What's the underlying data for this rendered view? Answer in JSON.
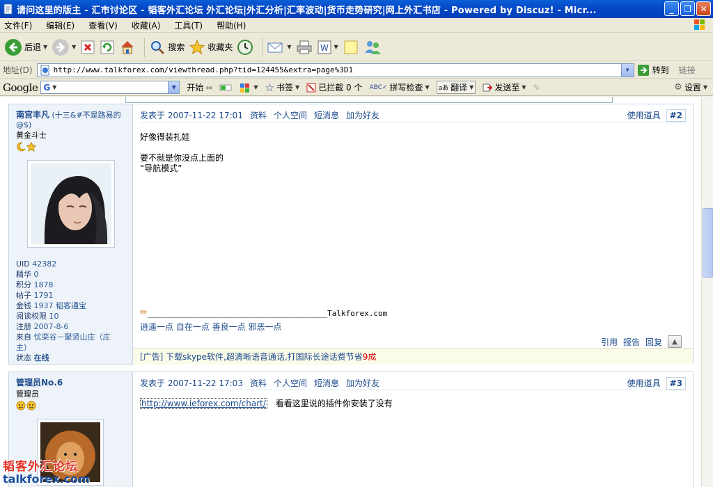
{
  "window": {
    "title": "请问这里的版主 - 汇市讨论区 - 韬客外汇论坛 外汇论坛|外汇分析|汇率波动|货币走势研究|网上外汇书店 - Powered by Discuz! - Micr...",
    "minimize": "_",
    "maximize": "❐",
    "close": "✕"
  },
  "menu": [
    "文件(F)",
    "编辑(E)",
    "查看(V)",
    "收藏(A)",
    "工具(T)",
    "帮助(H)"
  ],
  "toolbar": {
    "back": "后退",
    "search": "搜索",
    "favorites": "收藏夹"
  },
  "address": {
    "label": "地址(D)",
    "url": "http://www.talkforex.com/viewthread.php?tid=124455&extra=page%3D1",
    "go": "转到",
    "links": "链接"
  },
  "googlebar": {
    "logo": "Google",
    "g_label": "G",
    "start": "开始",
    "bookmarks": "书签",
    "blocked": "已拦截 0 个",
    "spellcheck": "拼写检查",
    "translate": "翻译",
    "sendto": "发送至",
    "settings": "设置"
  },
  "posts": [
    {
      "username": "南宫丰凡",
      "nick": "(十三&#不是路易的",
      "nick2": "@$)",
      "rank": "黄金斗士",
      "stats": [
        {
          "k": "UID",
          "v": "42382"
        },
        {
          "k": "精华",
          "v": "0"
        },
        {
          "k": "积分",
          "v": "1878"
        },
        {
          "k": "帖子",
          "v": "1791"
        },
        {
          "k": "金钱",
          "v": "1937 韬客通宝"
        },
        {
          "k": "阅读权限",
          "v": "10"
        },
        {
          "k": "注册",
          "v": "2007-8-6"
        },
        {
          "k": "来自",
          "v": "忧栾谷－聚贤山庄（庄"
        },
        {
          "k": "",
          "v": "主）"
        },
        {
          "k": "状态",
          "v": "在线"
        }
      ],
      "posted": "发表于 2007-11-22 17:01",
      "links": [
        "资料",
        "个人空间",
        "短消息",
        "加为好友"
      ],
      "tools": "使用道具",
      "floor": "#2",
      "body": [
        "好像得装扎娃",
        "",
        "要不就是你没点上面的",
        "“导航模式”"
      ],
      "sig_line": "_______________________________________Talkforex.com",
      "sig_text": "逍遥一点 自在一点 善良一点 邪恶一点",
      "actions": [
        "引用",
        "报告",
        "回复"
      ],
      "ad_prefix": "[广告] 下载skype软件,超清晰语音通话,打国际长途话费节省",
      "ad_red": "9成"
    },
    {
      "username": "管理员No.6",
      "rank": "管理员",
      "posted": "发表于 2007-11-22 17:03",
      "links": [
        "资料",
        "个人空间",
        "短消息",
        "加为好友"
      ],
      "tools": "使用道具",
      "floor": "#3",
      "link": "http://www.ieforex.com/chart/",
      "body_text": "看看这里说的插件你安装了没有"
    }
  ],
  "watermark": {
    "cn": "韬客外汇论坛",
    "en": "talkforex.com"
  }
}
